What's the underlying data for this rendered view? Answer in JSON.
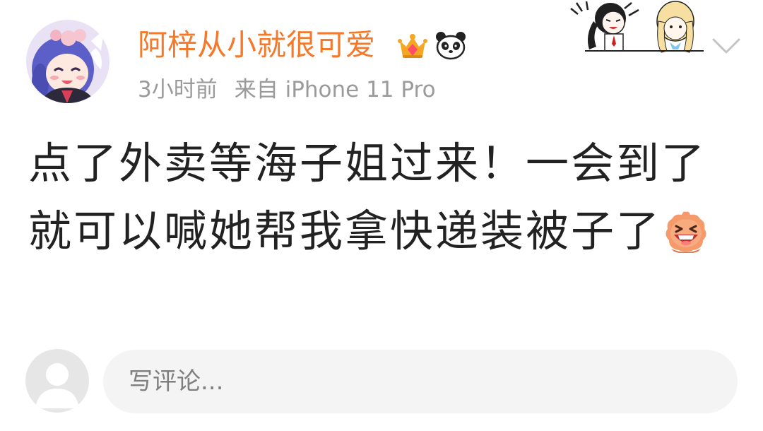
{
  "post": {
    "author": {
      "username": "阿梓从小就很可爱",
      "username_color": "#f5792a",
      "avatar_icon": "anime-girl-avatar",
      "badges": [
        "crown-badge-icon",
        "panda-badge-icon"
      ]
    },
    "meta": {
      "time": "3小时前",
      "source": "来自 iPhone 11 Pro",
      "color": "#9a9a9a"
    },
    "text": "点了外卖等海子姐过来！一会到了就可以喊她帮我拿快递装被子了",
    "inline_emoji": "laughing-emoji-icon",
    "decoration": "anime-characters-sticker",
    "expand_icon": "chevron-down-icon"
  },
  "comment": {
    "placeholder": "写评论...",
    "avatar_icon": "default-user-avatar",
    "box_color": "#f4f4f4"
  }
}
